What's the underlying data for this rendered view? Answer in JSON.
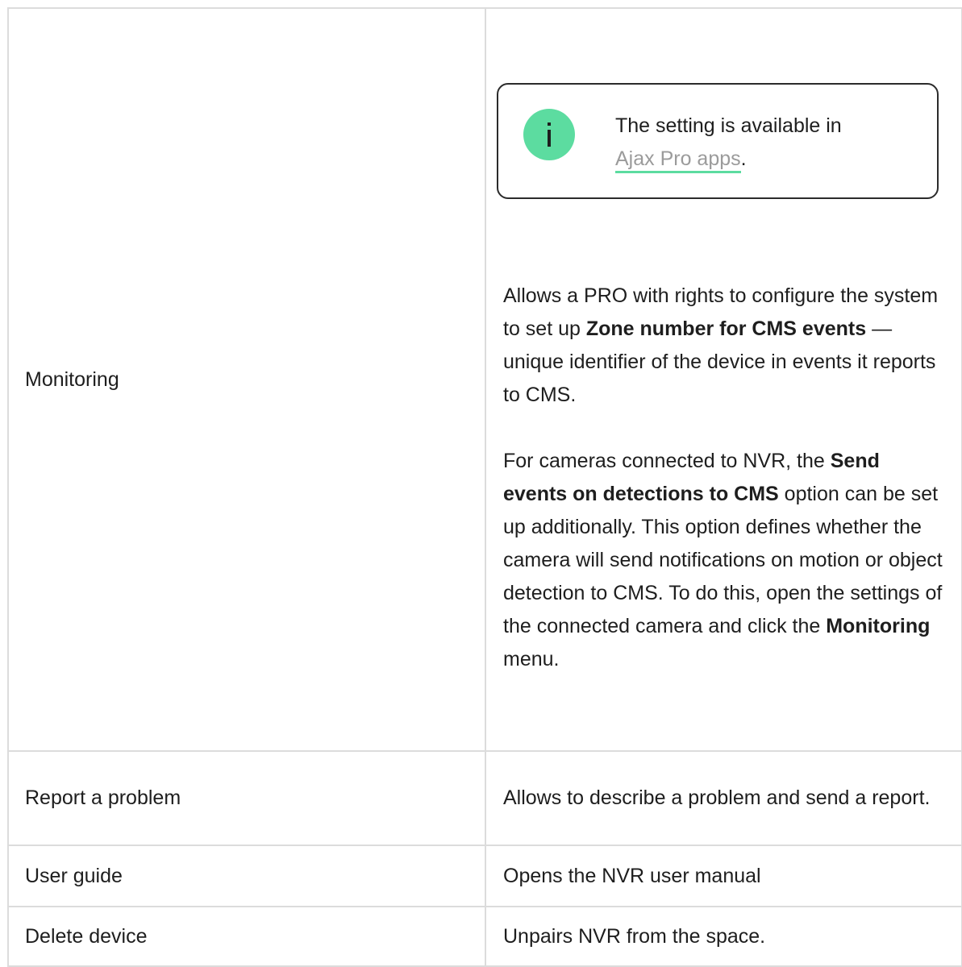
{
  "rows": {
    "monitoring": {
      "name": "Monitoring",
      "note": {
        "icon": "info-icon",
        "text_before": "The setting is available in",
        "link": "Ajax Pro apps",
        "text_after": "."
      },
      "para1": {
        "t1": "Allows a PRO with rights to configure the system to set up ",
        "b1": "Zone number for CMS events",
        "t2": " — unique identifier of the device in events it reports to CMS."
      },
      "para2": {
        "t1": "For cameras connected to NVR, the ",
        "b1": "Send events on detections to CMS",
        "t2": " option can be set up additionally. This option defines whether the camera will send notifications on motion or object detection to CMS. To do this, open the settings of the connected camera and click the ",
        "b2": "Monitoring",
        "t3": " menu."
      }
    },
    "report": {
      "name": "Report a problem",
      "desc": "Allows to describe a problem and send a report."
    },
    "guide": {
      "name": "User guide",
      "desc": "Opens the NVR user manual"
    },
    "delete": {
      "name": "Delete device",
      "desc": "Unpairs NVR from the space."
    }
  },
  "colors": {
    "accent": "#5cdca0",
    "border": "#dcdcdc",
    "link": "#9b9b9b",
    "text": "#1e1e1e"
  }
}
